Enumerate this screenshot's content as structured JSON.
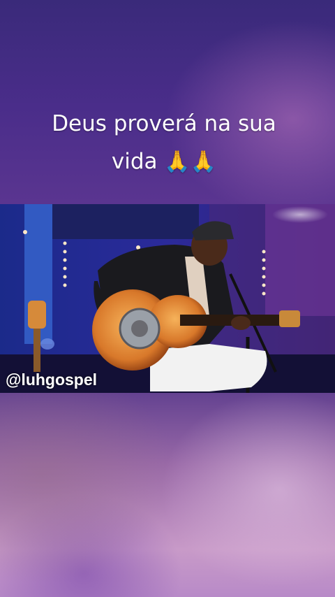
{
  "caption": {
    "line1": "Deus proverá na sua",
    "line2": "vida",
    "emoji": "🙏🙏"
  },
  "video": {
    "watermark": "@luhgospel",
    "icon": "video-frame-musician-guitar"
  }
}
